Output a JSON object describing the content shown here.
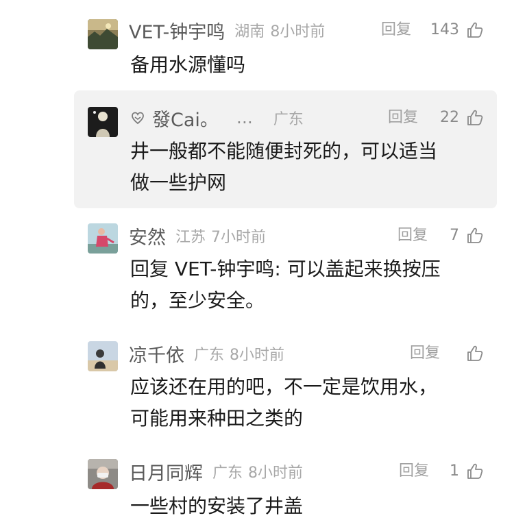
{
  "comments": [
    {
      "username": "VET-钟宇鸣",
      "location": "湖南",
      "time": "8小时前",
      "reply_label": "回复",
      "likes": "143",
      "text_lines": [
        "备用水源懂吗"
      ]
    },
    {
      "username": "發Cai。",
      "ellipsis": "…",
      "location": "广东",
      "time": "",
      "reply_label": "回复",
      "likes": "22",
      "text_lines": [
        "井一般都不能随便封死的，可以适当",
        "做一些护网"
      ]
    },
    {
      "username": "安然",
      "location": "江苏",
      "time": "7小时前",
      "reply_label": "回复",
      "likes": "7",
      "text_lines": [
        "回复 VET-钟宇鸣: 可以盖起来换按压",
        "的，至少安全。"
      ]
    },
    {
      "username": "凉千依",
      "location": "广东",
      "time": "8小时前",
      "reply_label": "回复",
      "likes": "",
      "text_lines": [
        "应该还在用的吧，不一定是饮用水，",
        "可能用来种田之类的"
      ]
    },
    {
      "username": "日月同辉",
      "location": "广东",
      "time": "8小时前",
      "reply_label": "回复",
      "likes": "1",
      "text_lines": [
        "一些村的安装了井盖"
      ]
    }
  ],
  "colors": {
    "highlight_bg": "#f2f2f2",
    "username": "#5a5a5a",
    "meta": "#a8a8a8",
    "text": "#1a1a1a"
  }
}
